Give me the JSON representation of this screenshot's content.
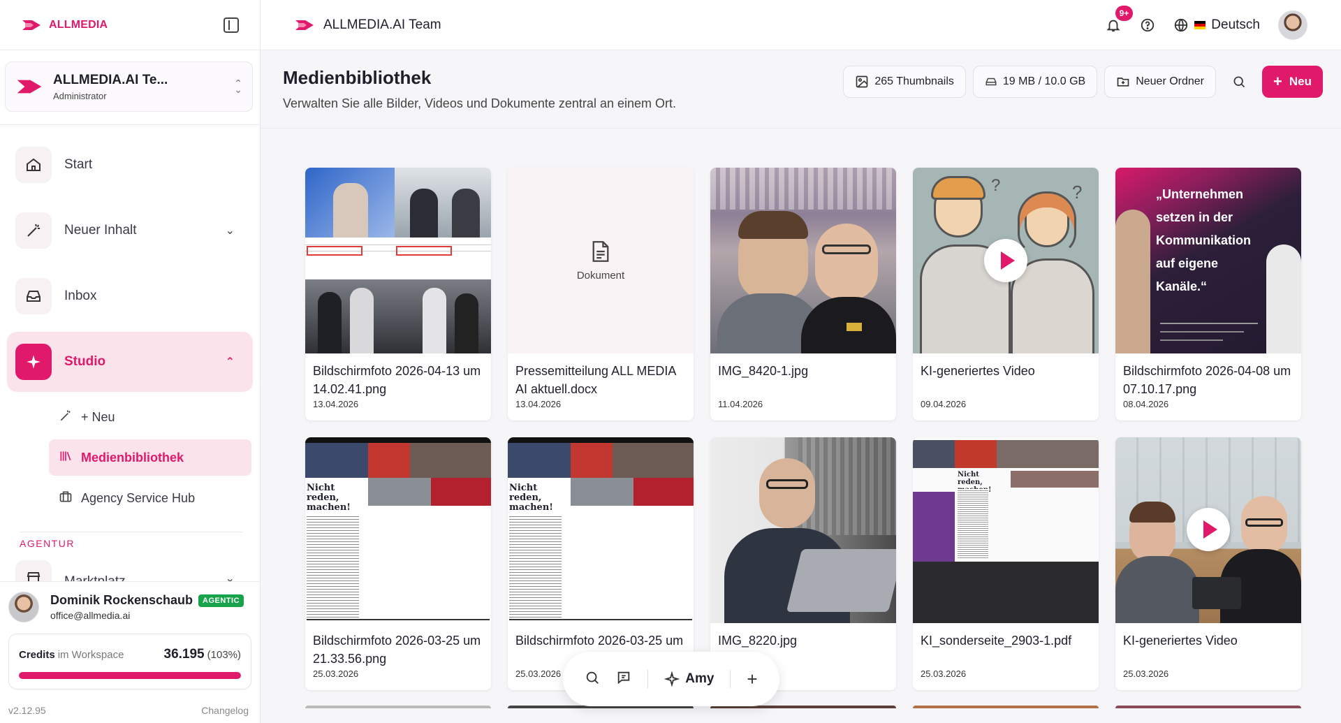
{
  "brand": {
    "name": "ALLMEDIA",
    "accent": "#e0196a"
  },
  "workspace": {
    "name": "ALLMEDIA.AI Te...",
    "role": "Administrator"
  },
  "nav": {
    "start": "Start",
    "neuer_inhalt": "Neuer Inhalt",
    "inbox": "Inbox",
    "studio": "Studio",
    "sub_neu": "+ Neu",
    "sub_medien": "Medienbibliothek",
    "sub_agency": "Agency Service Hub",
    "section_agentur": "AGENTUR",
    "marktplatz": "Marktplatz"
  },
  "user": {
    "name": "Dominik Rockenschaub",
    "badge": "AGENTIC",
    "email": "office@allmedia.ai"
  },
  "credits": {
    "label": "Credits",
    "sub": "im Workspace",
    "value": "36.195",
    "percent": "(103%)",
    "fill_ratio": 1.0
  },
  "footer": {
    "version": "v2.12.95",
    "changelog": "Changelog"
  },
  "topbar": {
    "team": "ALLMEDIA.AI Team",
    "notif": "9+",
    "language": "Deutsch"
  },
  "page": {
    "title": "Medienbibliothek",
    "subtitle": "Verwalten Sie alle Bilder, Videos und Dokumente zentral an einem Ort.",
    "thumbs": "265 Thumbnails",
    "storage": "19 MB / 10.0 GB",
    "new_folder": "Neuer Ordner",
    "new": "Neu"
  },
  "media": [
    {
      "title": "Bildschirmfoto 2026-04-13 um 14.02.41.png",
      "date": "13.04.2026",
      "kind": "collage"
    },
    {
      "title": "Pressemitteilung ALL MEDIA AI aktuell.docx",
      "date": "13.04.2026",
      "kind": "document",
      "doc_label": "Dokument"
    },
    {
      "title": "IMG_8420-1.jpg",
      "date": "11.04.2026",
      "kind": "photo-stadium"
    },
    {
      "title": "KI-generiertes Video",
      "date": "09.04.2026",
      "kind": "video-sketch"
    },
    {
      "title": "Bildschirmfoto 2026-04-08 um 07.10.17.png",
      "date": "08.04.2026",
      "kind": "quote-graphic",
      "quote": "„Unternehmen setzen in der Kommunikation auf eigene Kanäle.“"
    },
    {
      "title": "Bildschirmfoto 2026-03-25 um 21.33.56.png",
      "date": "25.03.2026",
      "kind": "newspaper",
      "headline": "Nicht reden, machen!"
    },
    {
      "title": "Bildschirmfoto 2026-03-25 um",
      "date": "25.03.2026",
      "kind": "newspaper",
      "headline": "Nicht reden, machen!"
    },
    {
      "title": "IMG_8220.jpg",
      "date": "",
      "kind": "photo-laptop"
    },
    {
      "title": "KI_sonderseite_2903-1.pdf",
      "date": "25.03.2026",
      "kind": "newspaper-pdf",
      "headline": "Nicht reden, machen!"
    },
    {
      "title": "KI-generiertes Video",
      "date": "25.03.2026",
      "kind": "video-office"
    }
  ],
  "dock": {
    "assistant": "Amy"
  }
}
